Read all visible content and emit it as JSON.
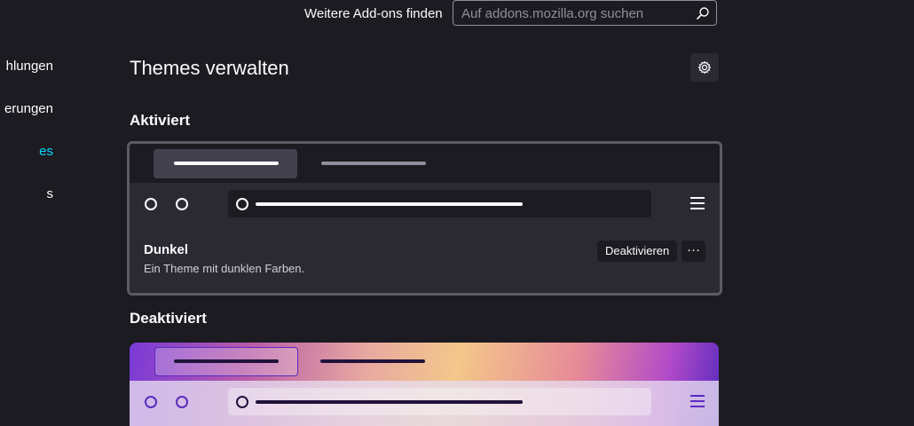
{
  "header": {
    "find_more_label": "Weitere Add-ons finden",
    "search_placeholder": "Auf addons.mozilla.org suchen"
  },
  "sidebar": {
    "items": [
      {
        "label": "hlungen"
      },
      {
        "label": "erungen"
      },
      {
        "label": "es"
      },
      {
        "label": "s"
      }
    ]
  },
  "main": {
    "title": "Themes verwalten",
    "enabled_heading": "Aktiviert",
    "disabled_heading": "Deaktiviert",
    "enabled_theme": {
      "name": "Dunkel",
      "description": "Ein Theme mit dunklen Farben.",
      "deactivate_label": "Deaktivieren",
      "more_label": "···"
    }
  },
  "colors": {
    "background": "#1c1b22",
    "accent": "#00ddff",
    "card": "#2b2a33"
  }
}
